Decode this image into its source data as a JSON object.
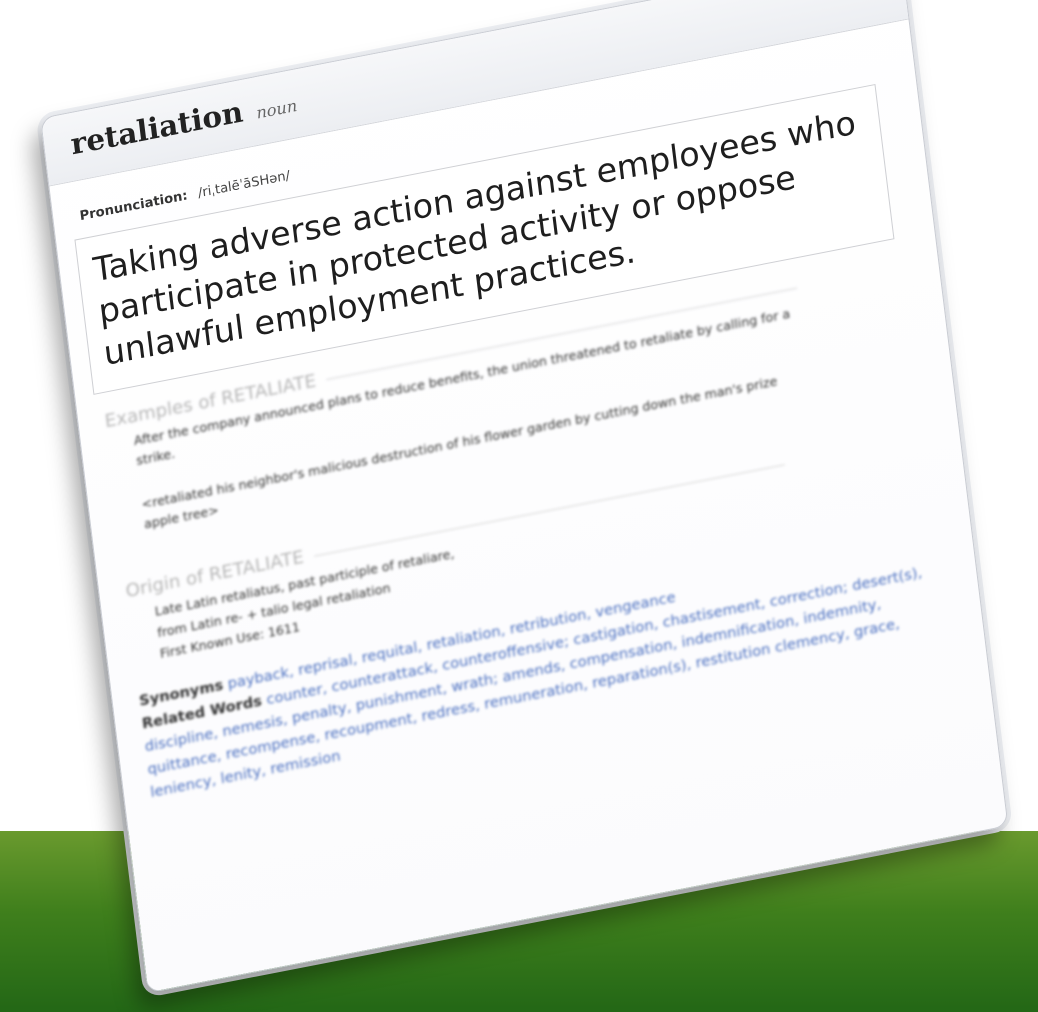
{
  "entry": {
    "word": "retaliation",
    "part_of_speech": "noun",
    "pronunciation_label": "Pronunciation:",
    "pronunciation": "/riˌtalēˈāSHən/",
    "definition": "Taking adverse action against employees who participate in protected activity or oppose unlawful employment practices."
  },
  "examples": {
    "heading": "Examples of RETALIATE",
    "items": [
      "After the company announced plans to reduce benefits, the union threatened to retaliate by calling for a strike.",
      "<retaliated his neighbor's malicious destruction of his flower garden by cutting down the man's prize apple tree>"
    ]
  },
  "origin": {
    "heading": "Origin of RETALIATE",
    "lines": [
      "Late Latin retaliatus, past participle of retaliare,",
      "from Latin re- + talio legal retaliation",
      "First Known Use: 1611"
    ]
  },
  "synonyms": {
    "label": "Synonyms",
    "items": [
      "payback,",
      "reprisal,",
      "requital,",
      "retaliation,",
      "retribution,",
      "vengeance"
    ]
  },
  "related": {
    "label": "Related Words",
    "text": "counter, counterattack, counteroffensive; castigation, chastisement, correction; desert(s), discipline, nemesis, penalty, punishment, wrath; amends, compensation, indemnification, indemnity, quittance, recompense, recoupment, redress, remuneration, reparation(s), restitution",
    "tail": "clemency, grace, leniency, lenity, remission"
  },
  "colors": {
    "green_bar": "#3f7f1c",
    "link": "#4a6fc0"
  }
}
